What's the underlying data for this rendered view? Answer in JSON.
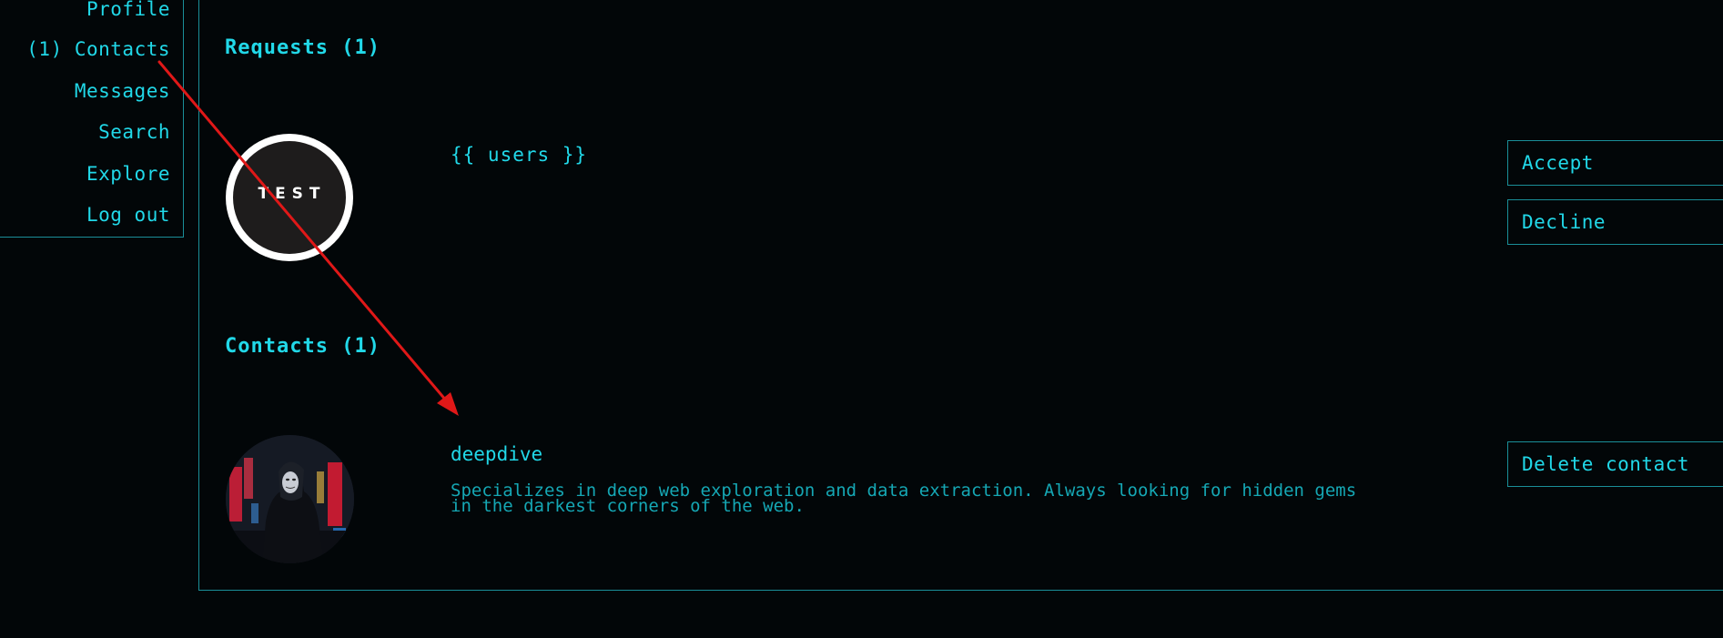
{
  "sidebar": {
    "items": [
      {
        "label": "Profile"
      },
      {
        "label": "(1) Contacts"
      },
      {
        "label": "Messages"
      },
      {
        "label": "Search"
      },
      {
        "label": "Explore"
      },
      {
        "label": "Log out"
      }
    ]
  },
  "requests": {
    "title": "Requests (1)",
    "item": {
      "avatar_text": "TEST",
      "name": "{{ users }}",
      "accept_label": "Accept",
      "decline_label": "Decline"
    }
  },
  "contacts": {
    "title": "Contacts (1)",
    "item": {
      "name": "deepdive",
      "bio": "Specializes in deep web exploration and data extraction. Always looking for hidden gems in the darkest corners of the web.",
      "delete_label": "Delete contact"
    }
  },
  "colors": {
    "background": "#020608",
    "accent": "#21d8e8",
    "border": "#1a8e98",
    "annotation_arrow": "#e01818"
  }
}
